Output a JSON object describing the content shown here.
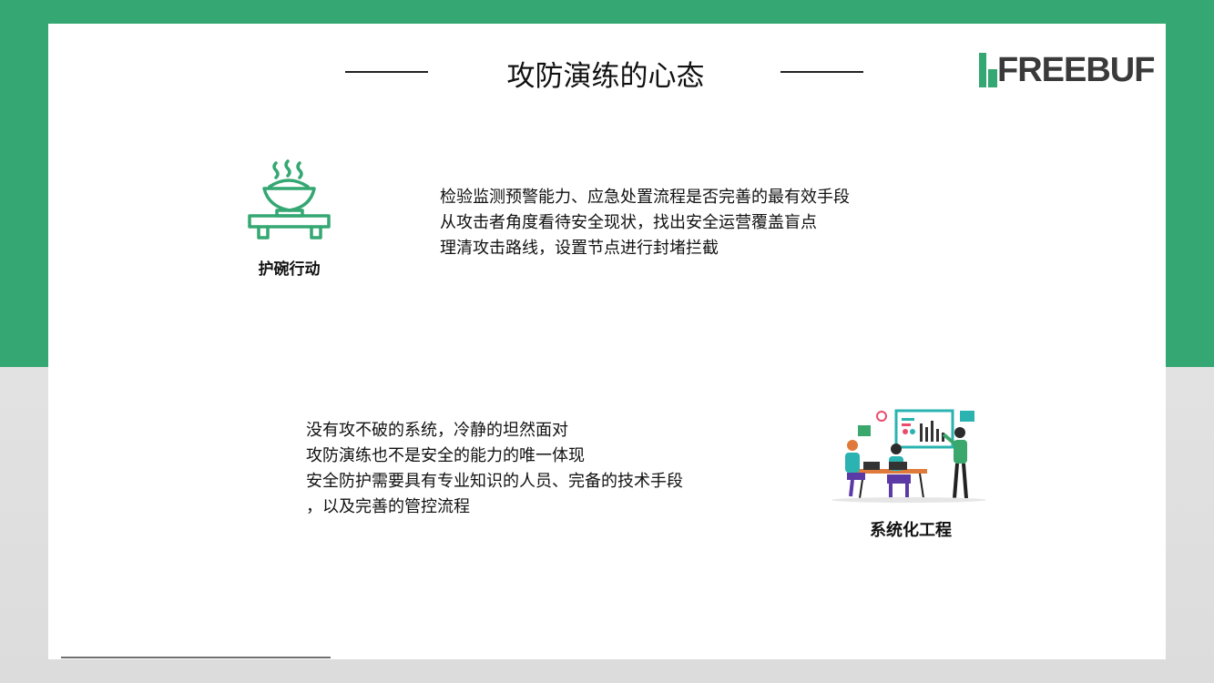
{
  "slide": {
    "title": "攻防演练的心态",
    "logo_text": "FREEBUF"
  },
  "section_bowl": {
    "icon": "bowl-icon",
    "label": "护碗行动",
    "lines": [
      "检验监测预警能力、应急处置流程是否完善的最有效手段",
      "从攻击者角度看待安全现状，找出安全运营覆盖盲点",
      "理清攻击路线，设置节点进行封堵拦截"
    ]
  },
  "section_system": {
    "icon": "team-illustration",
    "label": "系统化工程",
    "lines": [
      "没有攻不破的系统，冷静的坦然面对",
      "攻防演练也不是安全的能力的唯一体现",
      "安全防护需要具有专业知识的人员、完备的技术手段",
      "，以及完善的管控流程"
    ]
  },
  "colors": {
    "brand_green": "#34a772",
    "text": "#111111"
  }
}
